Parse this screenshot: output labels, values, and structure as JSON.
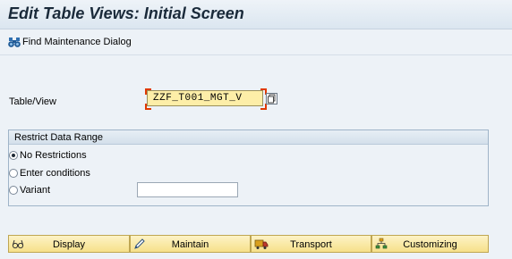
{
  "title": "Edit Table Views: Initial Screen",
  "toolbar": {
    "find_label": "Find Maintenance Dialog"
  },
  "table_view": {
    "label": "Table/View",
    "value": "ZZF_T001_MGT_V"
  },
  "restrict": {
    "heading": "Restrict Data Range",
    "options": [
      {
        "label": "No Restrictions",
        "checked": true
      },
      {
        "label": "Enter conditions",
        "checked": false
      },
      {
        "label": "Variant",
        "checked": false
      }
    ],
    "variant_value": ""
  },
  "buttons": {
    "display": "Display",
    "maintain": "Maintain",
    "transport": "Transport",
    "customizing": "Customizing"
  }
}
